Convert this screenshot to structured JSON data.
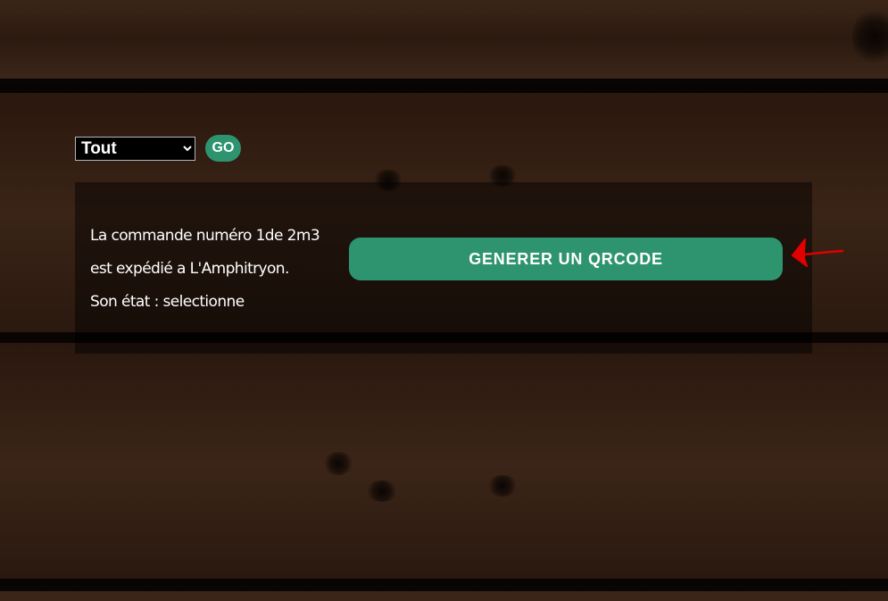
{
  "filter": {
    "selected": "Tout",
    "go_label": "GO"
  },
  "order": {
    "line1": "La commande numéro 1de 2m3",
    "line2": "est expédié a L'Amphitryon.",
    "line3": "Son état : selectionne"
  },
  "actions": {
    "qrcode_label": "GENERER UN QRCODE"
  },
  "colors": {
    "accent": "#2e9470",
    "annotation": "#e00000"
  }
}
